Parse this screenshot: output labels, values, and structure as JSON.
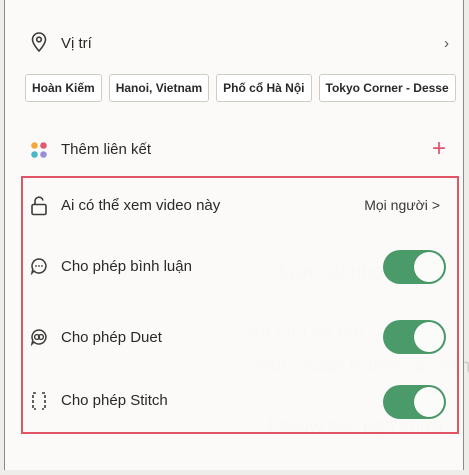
{
  "location": {
    "label": "Vị trí",
    "chips": [
      "Hoàn Kiếm",
      "Hanoi, Vietnam",
      "Phố cổ Hà Nội",
      "Tokyo Corner - Desse"
    ]
  },
  "add_link": {
    "label": "Thêm liên kết",
    "plus": "+"
  },
  "privacy": {
    "label": "Ai có thể xem video này",
    "value": "Mọi người",
    "chevron": ">"
  },
  "permissions": [
    {
      "label": "Cho phép bình luận",
      "icon": "comment-icon",
      "enabled": true
    },
    {
      "label": "Cho phép Duet",
      "icon": "duet-icon",
      "enabled": true
    },
    {
      "label": "Cho phép Stitch",
      "icon": "stitch-icon",
      "enabled": true
    }
  ],
  "colors": {
    "accent_red": "#e05464",
    "toggle_on": "#4a9a6a",
    "plus": "#e0546a"
  }
}
